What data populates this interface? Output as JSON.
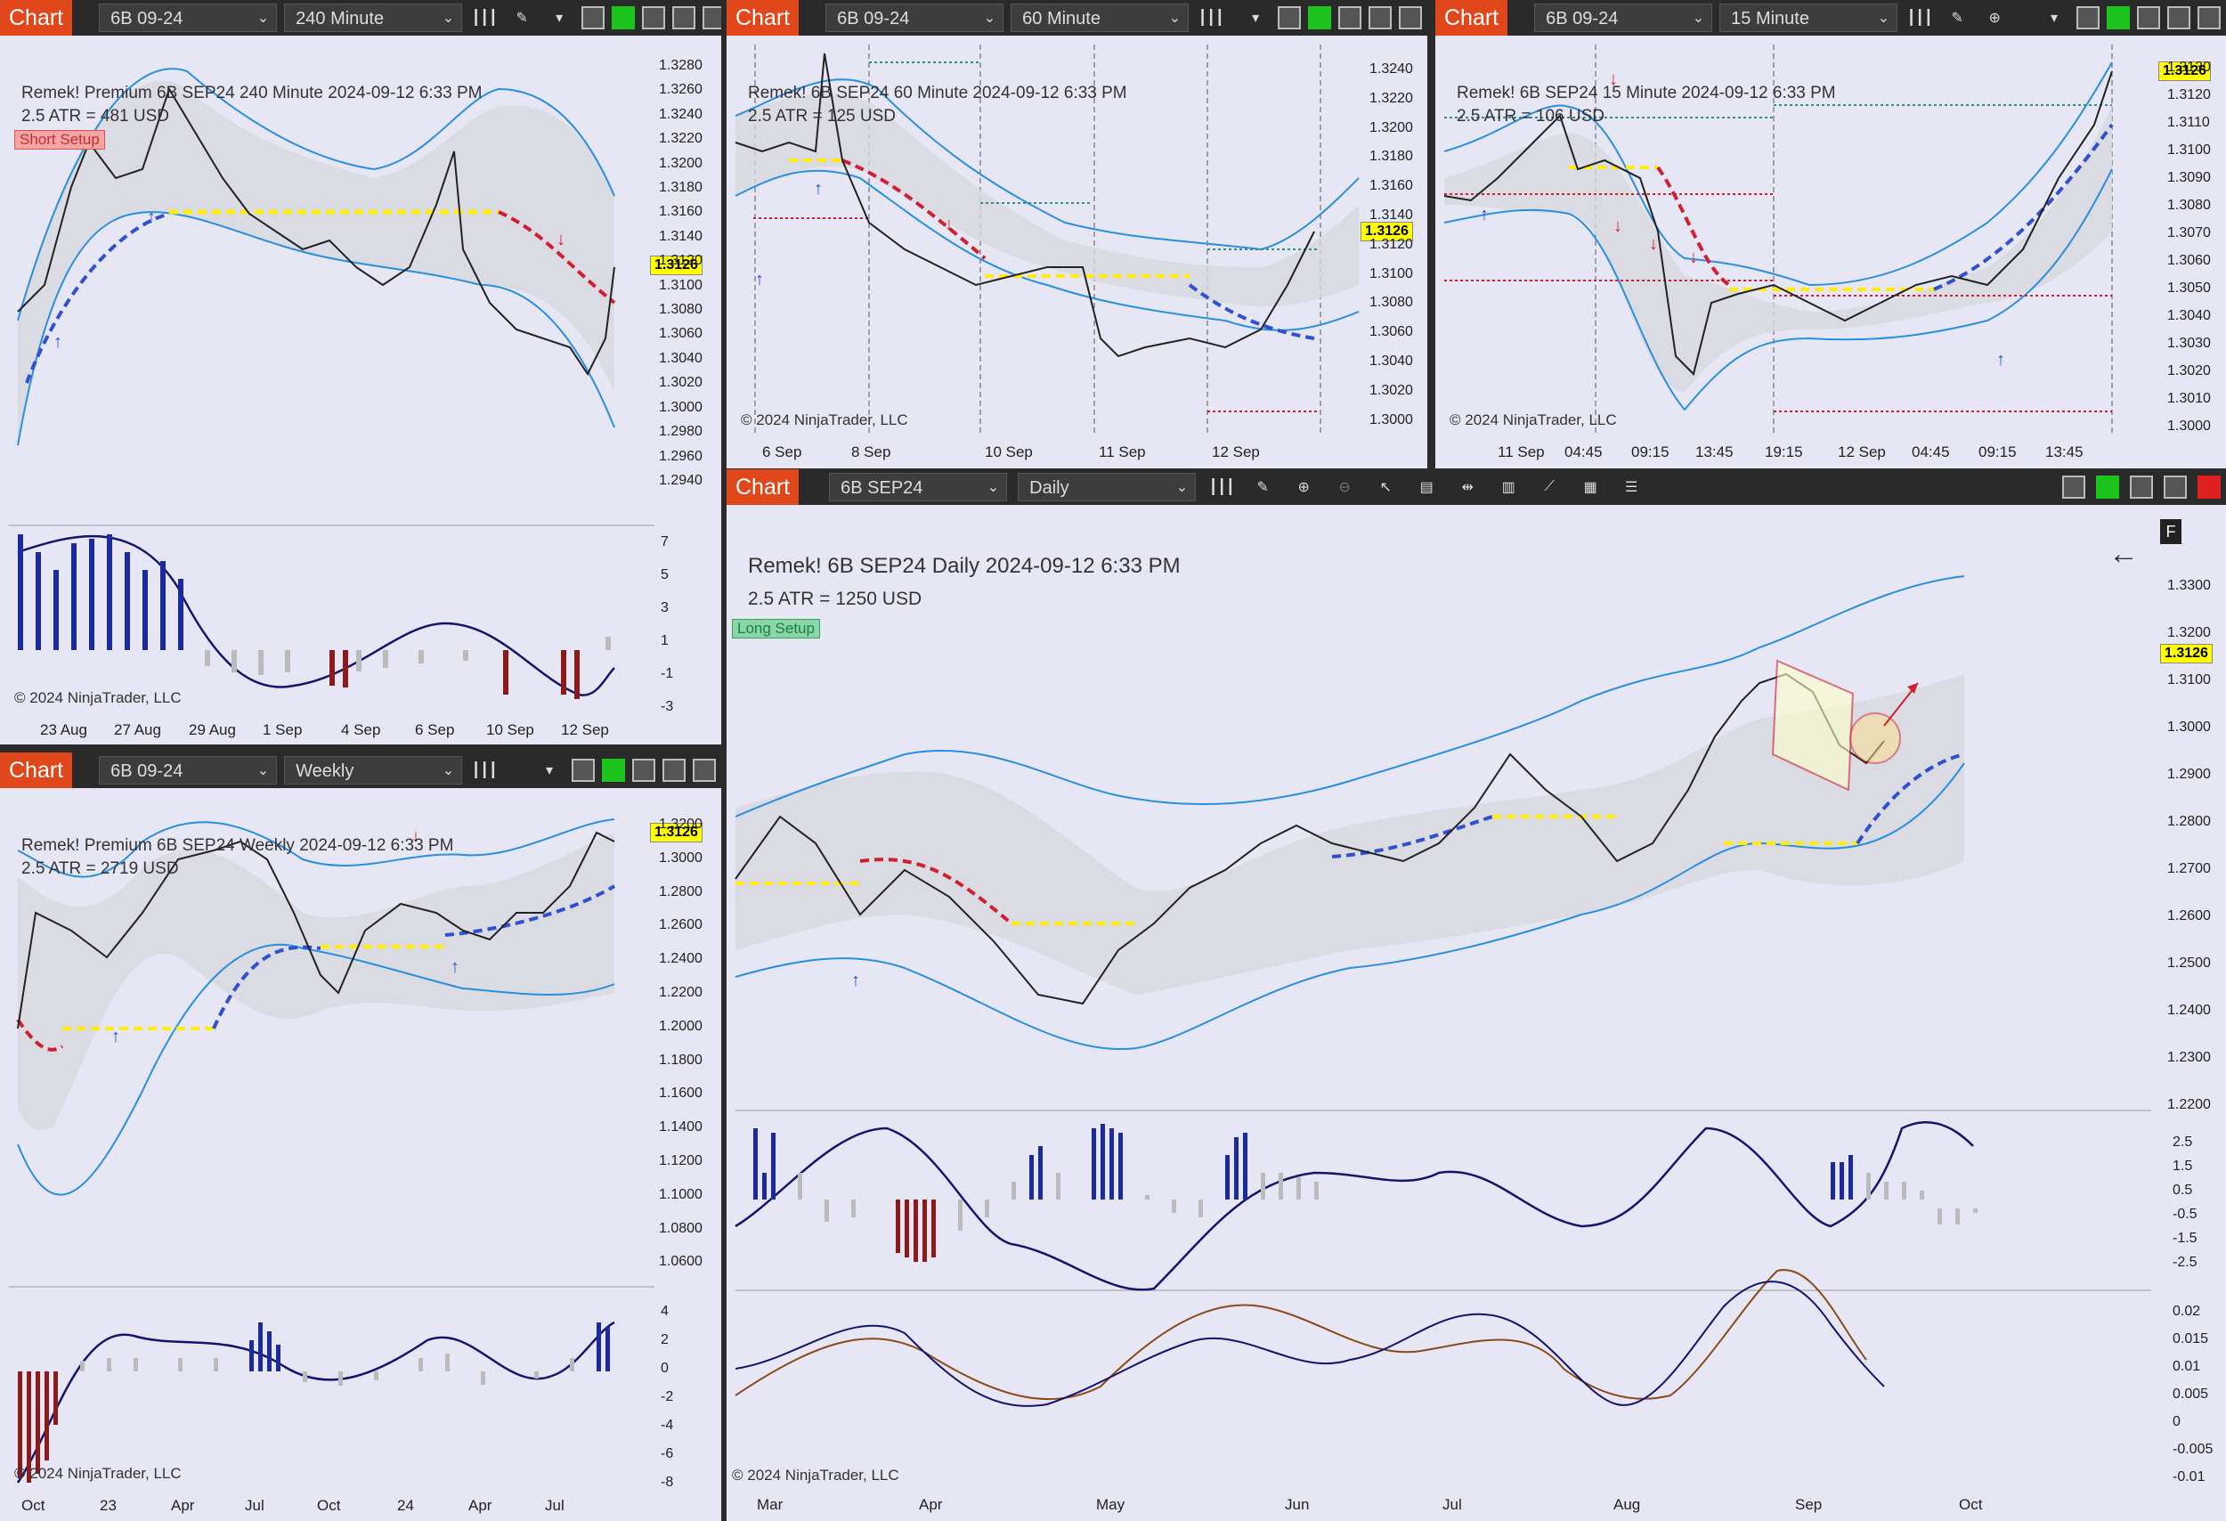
{
  "tab_label": "Chart",
  "price_tag": "1.3126",
  "copyright": "© 2024 NinjaTrader, LLC",
  "colors": {
    "tab": "#e0471a",
    "up": "#1c2b9c",
    "down": "#8b1a1a",
    "neutral": "#bbbbbb",
    "band": "#2a8fdc",
    "signal_up": "#3050d0",
    "signal_down": "#d02030",
    "signal_flat": "#ffee00"
  },
  "panels": {
    "p240": {
      "instrument": "6B 09-24",
      "interval": "240 Minute",
      "header": "Remek!  Premium  6B SEP24  240 Minute  2024-09-12 6:33 PM",
      "atr": "2.5 ATR = 481 USD",
      "badge": "Short Setup",
      "yticks": [
        "1.3280",
        "1.3260",
        "1.3240",
        "1.3220",
        "1.3200",
        "1.3180",
        "1.3160",
        "1.3140",
        "1.3120",
        "1.3100",
        "1.3080",
        "1.3060",
        "1.3040",
        "1.3020",
        "1.3000",
        "1.2980",
        "1.2960",
        "1.2940"
      ],
      "osc_ticks": [
        "7",
        "5",
        "3",
        "1",
        "-1",
        "-3"
      ],
      "xticks": [
        "23 Aug",
        "27 Aug",
        "29 Aug",
        "1 Sep",
        "4 Sep",
        "6 Sep",
        "10 Sep",
        "12 Sep"
      ]
    },
    "p60": {
      "instrument": "6B 09-24",
      "interval": "60 Minute",
      "header": "Remek!  6B SEP24  60 Minute  2024-09-12 6:33 PM",
      "atr": "2.5 ATR = 125 USD",
      "yticks": [
        "1.3240",
        "1.3220",
        "1.3200",
        "1.3180",
        "1.3160",
        "1.3140",
        "1.3120",
        "1.3100",
        "1.3080",
        "1.3060",
        "1.3040",
        "1.3020",
        "1.3000"
      ],
      "xticks": [
        "6 Sep",
        "8 Sep",
        "10 Sep",
        "11 Sep",
        "12 Sep"
      ]
    },
    "p15": {
      "instrument": "6B 09-24",
      "interval": "15 Minute",
      "header": "Remek!  6B SEP24  15 Minute  2024-09-12 6:33 PM",
      "atr": "2.5 ATR = 106 USD",
      "yticks": [
        "1.3130",
        "1.3120",
        "1.3110",
        "1.3100",
        "1.3090",
        "1.3080",
        "1.3070",
        "1.3060",
        "1.3050",
        "1.3040",
        "1.3030",
        "1.3020",
        "1.3010",
        "1.3000"
      ],
      "xticks": [
        "11 Sep",
        "04:45",
        "09:15",
        "13:45",
        "19:15",
        "12 Sep",
        "04:45",
        "09:15",
        "13:45"
      ]
    },
    "pw": {
      "instrument": "6B 09-24",
      "interval": "Weekly",
      "header": "Remek!  Premium  6B SEP24  Weekly  2024-09-12 6:33 PM",
      "atr": "2.5 ATR = 2719 USD",
      "yticks": [
        "1.3200",
        "1.3000",
        "1.2800",
        "1.2600",
        "1.2400",
        "1.2200",
        "1.2000",
        "1.1800",
        "1.1600",
        "1.1400",
        "1.1200",
        "1.1000",
        "1.0800",
        "1.0600"
      ],
      "osc_ticks": [
        "4",
        "2",
        "0",
        "-2",
        "-4",
        "-6",
        "-8"
      ],
      "xticks": [
        "Oct",
        "23",
        "Apr",
        "Jul",
        "Oct",
        "24",
        "Apr",
        "Jul"
      ]
    },
    "pd": {
      "instrument": "6B SEP24",
      "interval": "Daily",
      "header": "Remek!  6B SEP24  Daily  2024-09-12 6:33 PM",
      "atr": "2.5 ATR = 1250 USD",
      "badge": "Long Setup",
      "f_button": "F",
      "yticks": [
        "1.3300",
        "1.3200",
        "1.3100",
        "1.3000",
        "1.2900",
        "1.2800",
        "1.2700",
        "1.2600",
        "1.2500",
        "1.2400",
        "1.2300",
        "1.2200"
      ],
      "osc_ticks": [
        "2.5",
        "1.5",
        "0.5",
        "-0.5",
        "-1.5",
        "-2.5"
      ],
      "osc2_ticks": [
        "0.02",
        "0.015",
        "0.01",
        "0.005",
        "0",
        "-0.005",
        "-0.01"
      ],
      "xticks": [
        "Mar",
        "Apr",
        "May",
        "Jun",
        "Jul",
        "Aug",
        "Sep",
        "Oct"
      ]
    }
  }
}
